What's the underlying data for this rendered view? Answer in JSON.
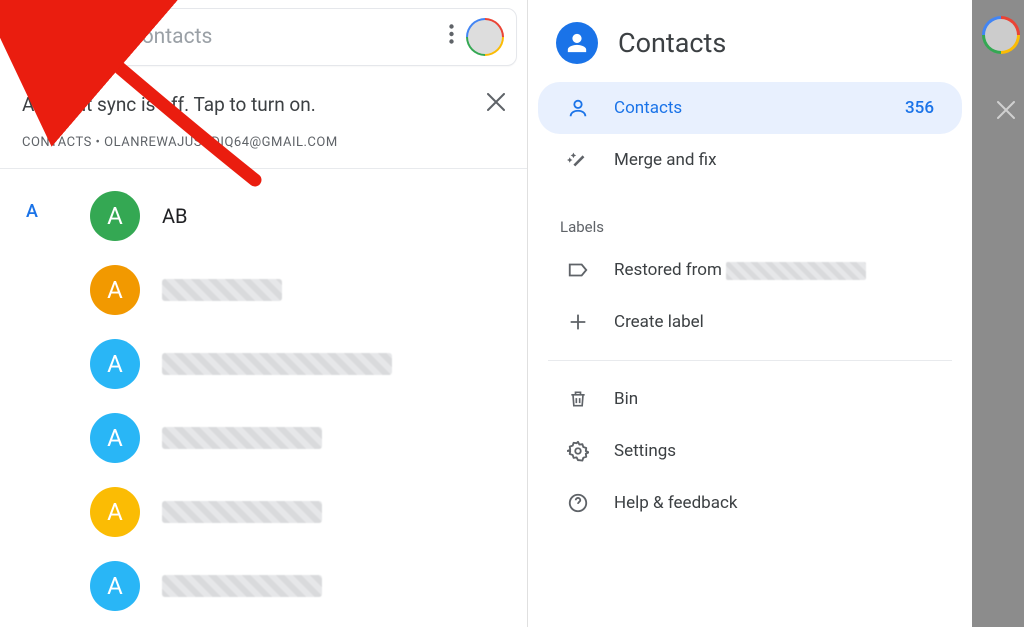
{
  "left": {
    "searchPlaceholder": "Search contacts",
    "syncMessage": "Account sync is off. Tap to turn on.",
    "accountLine": "CONTACTS • OLANREWAJUSODIQ64@GMAIL.COM",
    "sectionLetter": "A",
    "contacts": [
      {
        "initial": "A",
        "name": "AB",
        "color": "c-green",
        "blurred": false
      },
      {
        "initial": "A",
        "name": "",
        "color": "c-orange",
        "blurred": true,
        "blurClass": "blurred short"
      },
      {
        "initial": "A",
        "name": "",
        "color": "c-cyan",
        "blurred": true,
        "blurClass": "blurred wide"
      },
      {
        "initial": "A",
        "name": "",
        "color": "c-cyan",
        "blurred": true,
        "blurClass": "blurred"
      },
      {
        "initial": "A",
        "name": "",
        "color": "c-yellow",
        "blurred": true,
        "blurClass": "blurred"
      },
      {
        "initial": "A",
        "name": "",
        "color": "c-cyan",
        "blurred": true,
        "blurClass": "blurred"
      }
    ]
  },
  "right": {
    "title": "Contacts",
    "items": {
      "contacts": {
        "label": "Contacts",
        "count": "356"
      },
      "merge": "Merge and fix",
      "labelsHeader": "Labels",
      "restored": "Restored from",
      "createLabel": "Create label",
      "bin": "Bin",
      "settings": "Settings",
      "help": "Help & feedback"
    }
  }
}
